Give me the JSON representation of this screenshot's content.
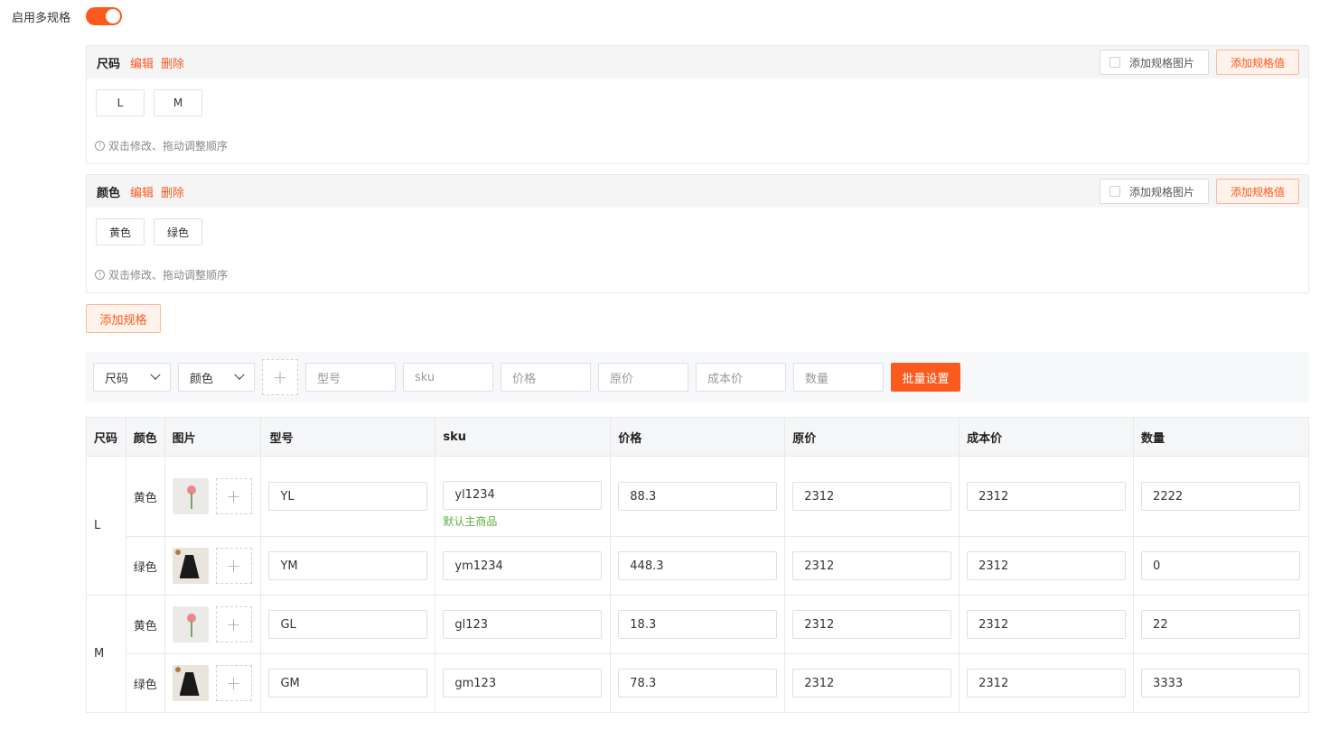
{
  "enable": {
    "label": "启用多规格",
    "on": true,
    "accent": "#fa5a1e"
  },
  "specs": [
    {
      "name": "尺码",
      "edit": "编辑",
      "delete": "删除",
      "img_check": "添加规格图片",
      "add_value": "添加规格值",
      "values": [
        "L",
        "M"
      ],
      "tip": "双击修改、拖动调整顺序"
    },
    {
      "name": "颜色",
      "edit": "编辑",
      "delete": "删除",
      "img_check": "添加规格图片",
      "add_value": "添加规格值",
      "values": [
        "黄色",
        "绿色"
      ],
      "tip": "双击修改、拖动调整顺序"
    }
  ],
  "add_spec": "添加规格",
  "batch": {
    "size_select": "尺码",
    "color_select": "颜色",
    "placeholders": {
      "model": "型号",
      "sku": "sku",
      "price": "价格",
      "orig": "原价",
      "cost": "成本价",
      "qty": "数量"
    },
    "button": "批量设置"
  },
  "table": {
    "headers": {
      "size": "尺码",
      "color": "颜色",
      "image": "图片",
      "model": "型号",
      "sku": "sku",
      "price": "价格",
      "orig": "原价",
      "cost": "成本价",
      "qty": "数量"
    },
    "rows": [
      {
        "size": "L",
        "color": "黄色",
        "image": "flower",
        "model": "YL",
        "sku": "yl1234",
        "default": "默认主商品",
        "price": "88.3",
        "orig": "2312",
        "cost": "2312",
        "qty": "2222"
      },
      {
        "size": "L",
        "color": "绿色",
        "image": "skirt",
        "model": "YM",
        "sku": "ym1234",
        "default": "",
        "price": "448.3",
        "orig": "2312",
        "cost": "2312",
        "qty": "0"
      },
      {
        "size": "M",
        "color": "黄色",
        "image": "flower",
        "model": "GL",
        "sku": "gl123",
        "default": "",
        "price": "18.3",
        "orig": "2312",
        "cost": "2312",
        "qty": "22"
      },
      {
        "size": "M",
        "color": "绿色",
        "image": "skirt",
        "model": "GM",
        "sku": "gm123",
        "default": "",
        "price": "78.3",
        "orig": "2312",
        "cost": "2312",
        "qty": "3333"
      }
    ]
  }
}
